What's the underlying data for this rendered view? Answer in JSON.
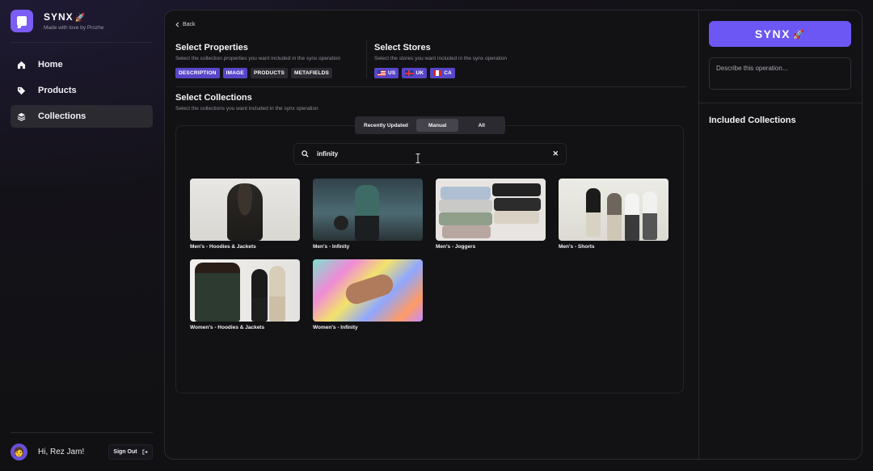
{
  "brand": {
    "name": "SYNX",
    "tagline": "Made with love by Prozhe",
    "accent": "#7b5cf5"
  },
  "sidebar": {
    "items": [
      {
        "label": "Home",
        "icon": "home-icon",
        "active": false
      },
      {
        "label": "Products",
        "icon": "tag-icon",
        "active": false
      },
      {
        "label": "Collections",
        "icon": "layers-icon",
        "active": true
      }
    ]
  },
  "user": {
    "greeting": "Hi, Rez Jam!",
    "avatar": "avatar-emoji",
    "sign_out": "Sign Out"
  },
  "main": {
    "back": "Back",
    "properties": {
      "title": "Select Properties",
      "subtitle": "Select the collection properties you want included in the synx operation",
      "chips": [
        {
          "label": "DESCRIPTION",
          "selected": true
        },
        {
          "label": "IMAGE",
          "selected": true
        },
        {
          "label": "PRODUCTS",
          "selected": false
        },
        {
          "label": "METAFIELDS",
          "selected": false
        }
      ]
    },
    "stores": {
      "title": "Select Stores",
      "subtitle": "Select the stores you want included in the synx operation",
      "chips": [
        {
          "label": "US",
          "flag": "us"
        },
        {
          "label": "UK",
          "flag": "uk"
        },
        {
          "label": "CA",
          "flag": "ca"
        }
      ]
    },
    "collections": {
      "title": "Select Collections",
      "subtitle": "Select the collections you want included in the synx operation",
      "filters": [
        {
          "label": "Recently Updated",
          "active": false
        },
        {
          "label": "Manual",
          "active": true
        },
        {
          "label": "All",
          "active": false
        }
      ],
      "search_value": "infinity",
      "items": [
        {
          "label": "Men's - Hoodies & Jackets"
        },
        {
          "label": "Men's - Infinity"
        },
        {
          "label": "Men's - Joggers"
        },
        {
          "label": "Men's - Shorts"
        },
        {
          "label": "Women's - Hoodies & Jackets"
        },
        {
          "label": "Women's - Infinity"
        }
      ]
    }
  },
  "right": {
    "synx_button": "SYNX",
    "description_placeholder": "Describe this operation...",
    "included_title": "Included Collections"
  },
  "colors": {
    "selected_chip": "#5846c9",
    "synx_button": "#6c57f4"
  }
}
